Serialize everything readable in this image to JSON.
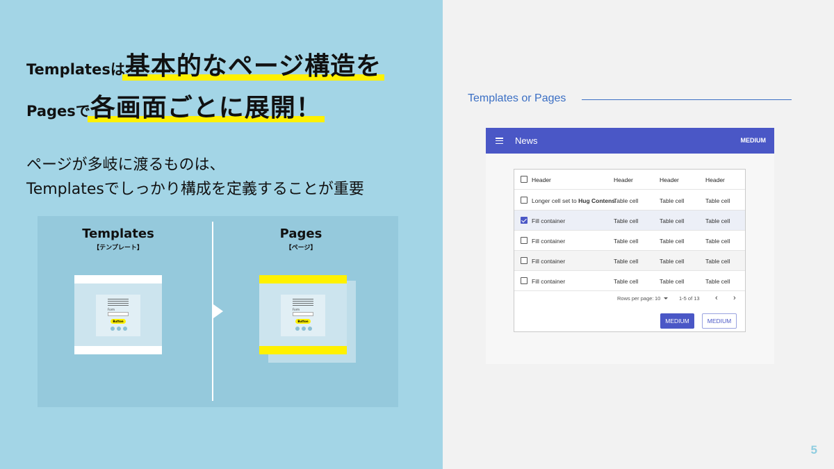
{
  "headline": {
    "line1_small": "Templatesは",
    "line1_big": "基本的なページ構造を",
    "line2_small": "Pagesで",
    "line2_big": "各画面ごとに展開！"
  },
  "subtext": {
    "line1": "ページが多岐に渡るものは、",
    "line2": "Templatesでしっかり構成を定義することが重要"
  },
  "diagram": {
    "templates_title": "Templates",
    "templates_sub": "【テンプレート】",
    "pages_title": "Pages",
    "pages_sub": "【ページ】",
    "mock_label": "Form",
    "mock_button": "Button"
  },
  "right_panel": {
    "title": "Templates or  Pages"
  },
  "app": {
    "title": "News",
    "action": "MEDIUM",
    "table": {
      "headers": [
        "Header",
        "Header",
        "Header",
        "Header"
      ],
      "rows": [
        {
          "c0_prefix": "Longer cell set to ",
          "c0_bold": "Hug Contens",
          "c1": "Table cell",
          "c2": "Table cell",
          "c3": "Table cell",
          "checked": false
        },
        {
          "c0": "Fill container",
          "c1": "Table cell",
          "c2": "Table cell",
          "c3": "Table cell",
          "checked": true
        },
        {
          "c0": "Fill container",
          "c1": "Table cell",
          "c2": "Table cell",
          "c3": "Table cell",
          "checked": false
        },
        {
          "c0": "Fill container",
          "c1": "Table cell",
          "c2": "Table cell",
          "c3": "Table cell",
          "checked": false
        },
        {
          "c0": "Fill container",
          "c1": "Table cell",
          "c2": "Table cell",
          "c3": "Table cell",
          "checked": false
        }
      ]
    },
    "pager": {
      "rows_per_page_label": "Rows per page:",
      "rows_per_page_value": "10",
      "range": "1-5 of 13"
    },
    "primary_button": "MEDIUM",
    "outline_button": "MEDIUM"
  },
  "page_number": "5",
  "colors": {
    "left_bg": "#a3d5e6",
    "highlight": "#fff100",
    "accent": "#4a57c6",
    "link_blue": "#3b6fc4"
  }
}
